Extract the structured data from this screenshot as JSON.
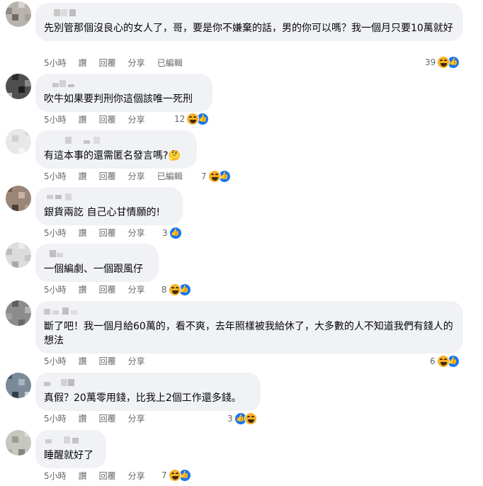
{
  "comments": [
    {
      "text": "先別管那個沒良心的女人了，哥，要是你不嫌棄的話，男的你可以嗎？我一個月只要10萬就好",
      "time": "5小時",
      "like": "讚",
      "reply": "回覆",
      "share": "分享",
      "edited": "已編輯",
      "reaction_count": "39"
    },
    {
      "text": "吹牛如果要判刑你這個該唯一死刑",
      "time": "5小時",
      "like": "讚",
      "reply": "回覆",
      "share": "分享",
      "reaction_count": "12"
    },
    {
      "text": "有這本事的還需匿名發言嗎?",
      "emoji": "🤔",
      "time": "5小時",
      "like": "讚",
      "reply": "回覆",
      "share": "分享",
      "edited": "已編輯",
      "reaction_count": "7"
    },
    {
      "text": "銀貨兩訖 自己心甘情願的!",
      "time": "5小時",
      "like": "讚",
      "reply": "回覆",
      "share": "分享",
      "reaction_count": "3"
    },
    {
      "text": "一個編劇、一個跟風仔",
      "time": "5小時",
      "like": "讚",
      "reply": "回覆",
      "share": "分享",
      "reaction_count": "8"
    },
    {
      "text": "斷了吧！我一個月給60萬的，看不爽，去年照樣被我給休了，大多數的人不知道我們有錢人的想法",
      "time": "5小時",
      "like": "讚",
      "reply": "回覆",
      "share": "分享",
      "reaction_count": "6"
    },
    {
      "text": "真假？20萬零用錢，比我上2個工作還多錢。",
      "time": "5小時",
      "like": "讚",
      "reply": "回覆",
      "share": "分享",
      "reaction_count": "3"
    },
    {
      "text": "睡醒就好了",
      "time": "5小時",
      "like": "讚",
      "reply": "回覆",
      "share": "分享",
      "reaction_count": "7"
    }
  ],
  "icons": {
    "haha": "haha-reaction-icon",
    "like": "like-reaction-icon",
    "thinking": "thinking-emoji"
  },
  "colors": {
    "bubble": "#f0f2f5",
    "meta_text": "#65676b",
    "like_blue": "#1877f2",
    "haha_yellow": "#f7b125"
  }
}
